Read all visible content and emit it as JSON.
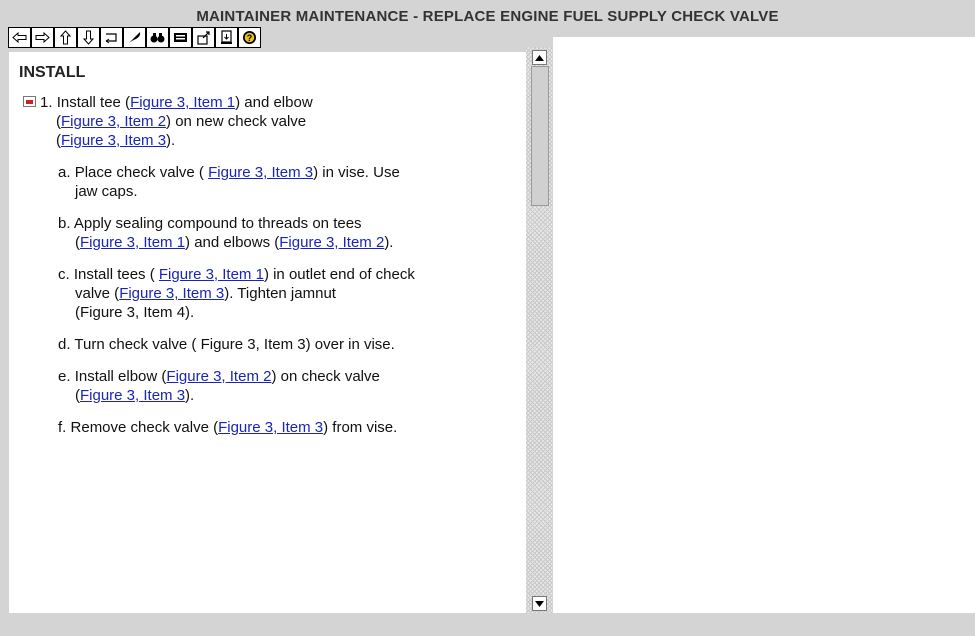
{
  "window": {
    "title": "MAINTAINER MAINTENANCE - REPLACE ENGINE  FUEL  SUPPLY CHECK VALVE"
  },
  "toolbar": {
    "buttons": [
      {
        "icon": "back-arrow-icon"
      },
      {
        "icon": "forward-arrow-icon"
      },
      {
        "icon": "up-arrow-icon"
      },
      {
        "icon": "down-arrow-icon"
      },
      {
        "icon": "return-icon"
      },
      {
        "icon": "feather-icon"
      },
      {
        "icon": "binoculars-icon"
      },
      {
        "icon": "keyboard-icon"
      },
      {
        "icon": "signpost-icon"
      },
      {
        "icon": "exit-icon"
      },
      {
        "icon": "help-icon"
      }
    ]
  },
  "section": {
    "title": "INSTALL"
  },
  "step": {
    "number": "1.",
    "l1a": "Install tee (",
    "l1link": "Figure 3, Item  1",
    "l1b": ") and elbow",
    "l2a": "(",
    "l2link": "Figure 3, Item  2",
    "l2b": ") on new check valve",
    "l3a": "(",
    "l3link": "Figure 3, Item  3",
    "l3b": ")."
  },
  "substeps": {
    "a": {
      "label": "a.",
      "l1a": "Place check valve ( ",
      "l1link": "Figure 3, Item 3",
      "l1b": ") in  vise. Use",
      "l2": "jaw caps."
    },
    "b": {
      "label": "b.",
      "l1": "Apply sealing compound to threads on tees",
      "l2a": "(",
      "l2link1": "Figure 3, Item  1",
      "l2b": ") and elbows (",
      "l2link2": "Figure  3, Item  2",
      "l2c": ")."
    },
    "c": {
      "label": "c.",
      "l1a": "Install tees ( ",
      "l1link": "Figure 3, Item  1",
      "l1b": ") in  outlet end of check",
      "l2a": "valve (",
      "l2link": "Figure 3, Item  3",
      "l2b": "). Tighten jamnut",
      "l3": "(Figure 3, Item  4)."
    },
    "d": {
      "label": "d.",
      "l1": "Turn check valve ( Figure 3, Item  3) over in  vise."
    },
    "e": {
      "label": "e.",
      "l1a": "Install elbow (",
      "l1link": "Figure 3, Item  2",
      "l1b": ") on check valve",
      "l2a": "(",
      "l2link": "Figure 3, Item  3",
      "l2b": ")."
    },
    "f": {
      "label": "f.",
      "l1a": "Remove check valve (",
      "l1link": "Figure 3, Item  3",
      "l1b": ") from vise."
    }
  },
  "scrollbar": {
    "position": 0.0
  }
}
